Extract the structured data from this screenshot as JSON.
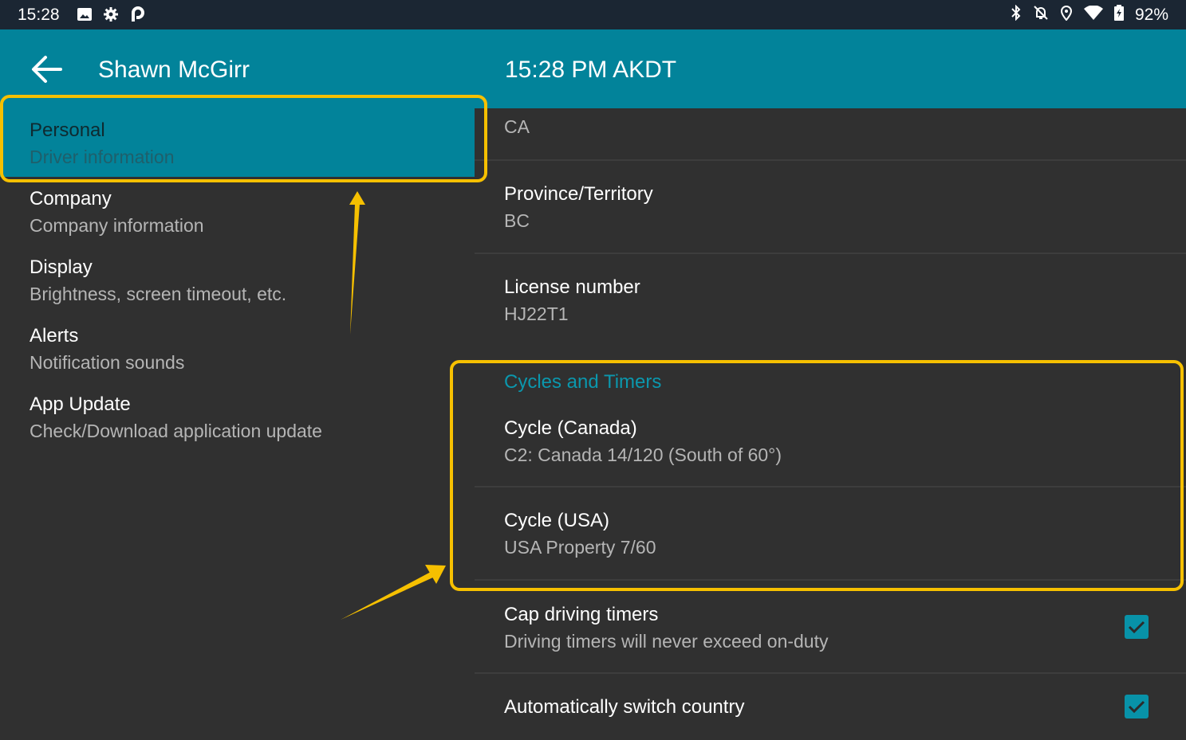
{
  "status_bar": {
    "time": "15:28",
    "left_icons": [
      "image-icon",
      "gear-icon",
      "parking-icon"
    ],
    "right_icons": [
      "bluetooth-icon",
      "notifications-off-icon",
      "location-icon",
      "wifi-icon",
      "battery-charging-icon"
    ],
    "battery": "92%"
  },
  "app_bar": {
    "back_icon": "arrow-back-icon",
    "title": "Shawn McGirr",
    "clock": "15:28 PM AKDT"
  },
  "sidebar": {
    "items": [
      {
        "title": "Personal",
        "subtitle": "Driver information",
        "selected": true
      },
      {
        "title": "Company",
        "subtitle": "Company information",
        "selected": false
      },
      {
        "title": "Display",
        "subtitle": "Brightness, screen timeout, etc.",
        "selected": false
      },
      {
        "title": "Alerts",
        "subtitle": "Notification sounds",
        "selected": false
      },
      {
        "title": "App Update",
        "subtitle": "Check/Download application update",
        "selected": false
      }
    ]
  },
  "content": {
    "partial_row_value": "CA",
    "rows": [
      {
        "title": "Province/Territory",
        "value": "BC"
      },
      {
        "title": "License number",
        "value": "HJ22T1"
      }
    ],
    "section": {
      "header": "Cycles and Timers",
      "rows": [
        {
          "title": "Cycle (Canada)",
          "value": "C2: Canada 14/120 (South of 60°)"
        },
        {
          "title": "Cycle (USA)",
          "value": "USA Property 7/60"
        }
      ]
    },
    "toggles": [
      {
        "title": "Cap driving timers",
        "subtitle": "Driving timers will never exceed on-duty",
        "checked": true
      },
      {
        "title": "Automatically switch country",
        "subtitle": "",
        "checked": true
      }
    ]
  },
  "colors": {
    "accent": "#02839a",
    "annotation": "#f6c000",
    "background": "#303030",
    "status_bar": "#1b2633"
  }
}
